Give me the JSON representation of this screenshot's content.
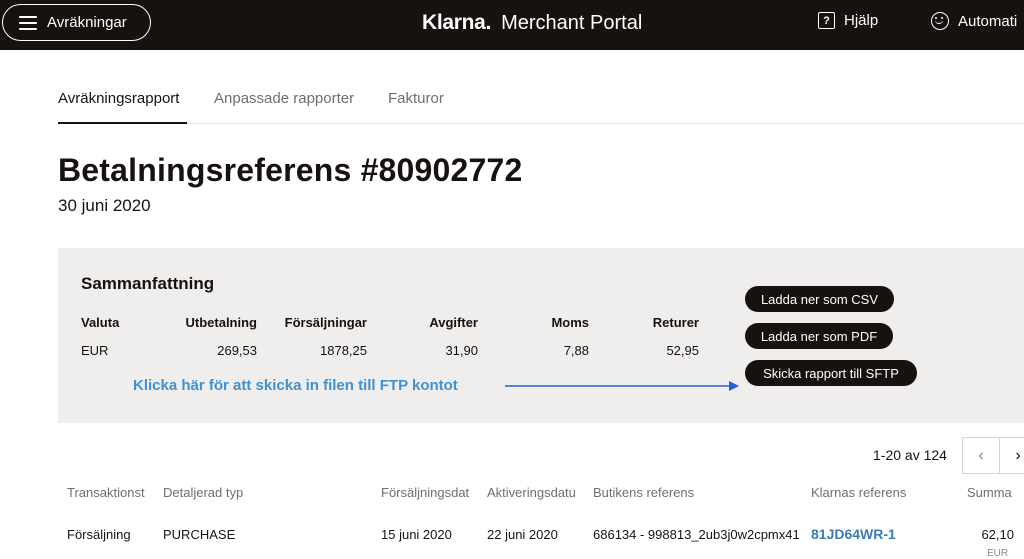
{
  "topbar": {
    "menu_label": "Avräkningar",
    "logo": "Klarna.",
    "portal": "Merchant Portal",
    "help": "Hjälp",
    "help_glyph": "?",
    "auto": "Automati"
  },
  "tabs": [
    {
      "label": "Avräkningsrapport",
      "active": true
    },
    {
      "label": "Anpassade rapporter",
      "active": false
    },
    {
      "label": "Fakturor",
      "active": false
    }
  ],
  "page": {
    "title": "Betalningsreferens #80902772",
    "date": "30 juni 2020"
  },
  "summary": {
    "heading": "Sammanfattning",
    "columns": [
      "Valuta",
      "Utbetalning",
      "Försäljningar",
      "Avgifter",
      "Moms",
      "Returer"
    ],
    "values": [
      "EUR",
      "269,53",
      "1878,25",
      "31,90",
      "7,88",
      "52,95"
    ],
    "buttons": {
      "csv": "Ladda ner som CSV",
      "pdf": "Ladda ner som PDF",
      "sftp": "Skicka rapport till SFTP"
    },
    "hint": "Klicka här för att skicka in filen till FTP kontot"
  },
  "pagination": {
    "info": "1-20 av 124",
    "prev": "‹",
    "next": "›"
  },
  "table": {
    "headers": [
      "Transaktionst",
      "Detaljerad typ",
      "Försäljningsdat",
      "Aktiveringsdatu",
      "Butikens referens",
      "Klarnas referens",
      "Summa"
    ],
    "rows": [
      [
        "Försäljning",
        "PURCHASE",
        "15 juni 2020",
        "22 juni 2020",
        "686134 - 998813_2ub3j0w2cpmx41",
        "81JD64WR-1",
        "62,10"
      ]
    ],
    "sub_currency": "EUR"
  },
  "colors": {
    "topbar": "#17120f",
    "panel": "#efeeec",
    "hint": "#3d92d6",
    "arrow": "#2a5dd8",
    "link": "#3a7cb5"
  }
}
